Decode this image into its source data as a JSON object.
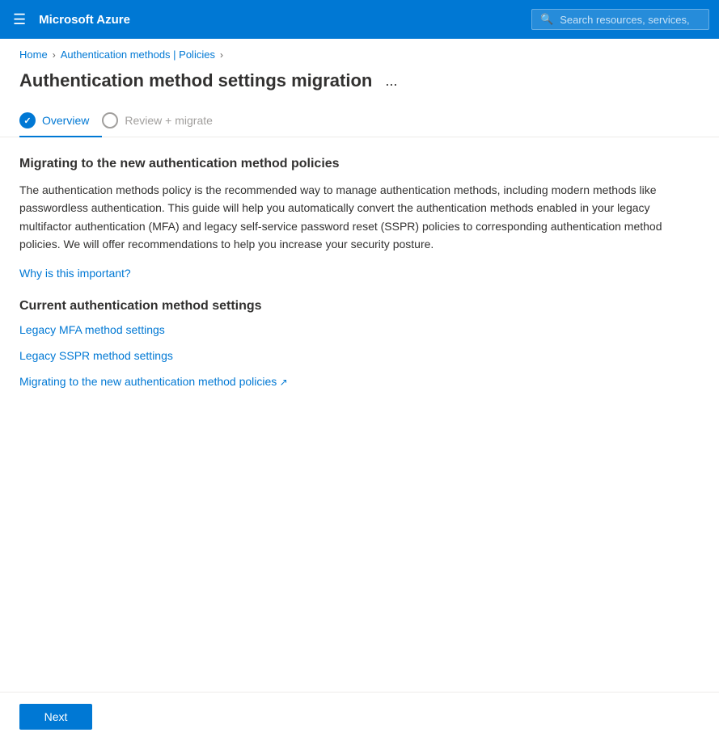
{
  "topnav": {
    "brand": "Microsoft Azure",
    "search_placeholder": "Search resources, services, an"
  },
  "breadcrumb": {
    "home": "Home",
    "section": "Authentication methods | Policies"
  },
  "page": {
    "title": "Authentication method settings migration",
    "ellipsis": "..."
  },
  "steps": [
    {
      "id": "overview",
      "label": "Overview",
      "active": true,
      "filled": true
    },
    {
      "id": "review-migrate",
      "label": "Review + migrate",
      "active": false,
      "filled": false
    }
  ],
  "content": {
    "migrating_heading": "Migrating to the new authentication method policies",
    "migrating_body": "The authentication methods policy is the recommended way to manage authentication methods, including modern methods like passwordless authentication. This guide will help you automatically convert the authentication methods enabled in your legacy multifactor authentication (MFA) and legacy self-service password reset (SSPR) policies to corresponding authentication method policies. We will offer recommendations to help you increase your security posture.",
    "why_link": "Why is this important?",
    "current_heading": "Current authentication method settings",
    "links": [
      {
        "id": "legacy-mfa",
        "text": "Legacy MFA method settings",
        "external": false
      },
      {
        "id": "legacy-sspr",
        "text": "Legacy SSPR method settings",
        "external": false
      },
      {
        "id": "migrating-link",
        "text": "Migrating to the new authentication method policies",
        "external": true
      }
    ]
  },
  "footer": {
    "next_label": "Next"
  }
}
